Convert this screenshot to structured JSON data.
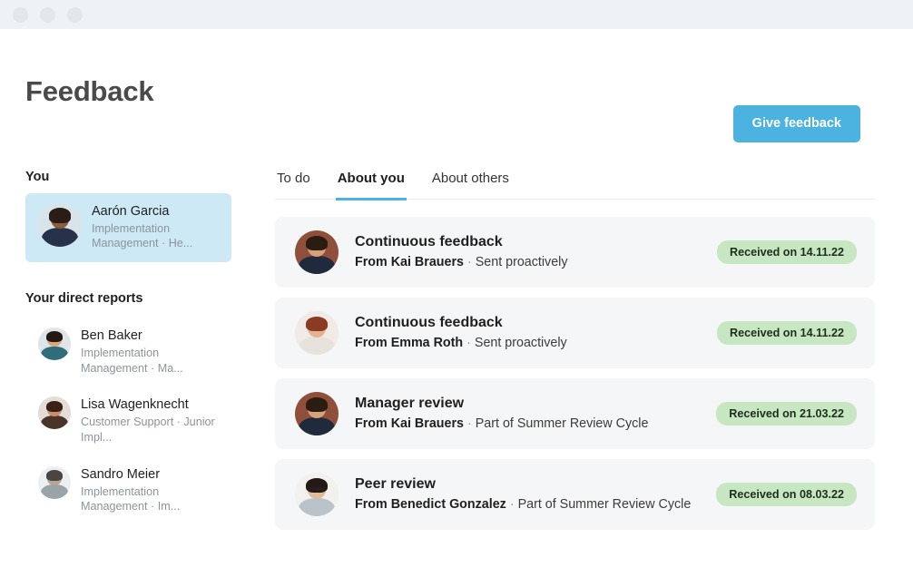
{
  "window": {
    "controls": [
      "close-dot",
      "minimize-dot",
      "maximize-dot"
    ]
  },
  "header": {
    "title": "Feedback",
    "give_feedback_label": "Give feedback",
    "accent_color": "#4cb3e0"
  },
  "sidebar": {
    "you_heading": "You",
    "you": {
      "name": "Aarón Garcia",
      "role": "Implementation Management · He...",
      "selected": true,
      "selected_bg": "#cde9f5"
    },
    "reports_heading": "Your direct reports",
    "reports": [
      {
        "name": "Ben Baker",
        "role": "Implementation Management · Ma..."
      },
      {
        "name": "Lisa Wagenknecht",
        "role": "Customer Support · Junior Impl..."
      },
      {
        "name": "Sandro Meier",
        "role": "Implementation Management · Im..."
      }
    ]
  },
  "main": {
    "tabs": [
      {
        "label": "To do",
        "active": false
      },
      {
        "label": "About you",
        "active": true
      },
      {
        "label": "About others",
        "active": false
      }
    ],
    "cards": [
      {
        "title": "Continuous feedback",
        "from": "From Kai Brauers",
        "separator": "·",
        "context": "Sent proactively",
        "badge": "Received on 14.11.22"
      },
      {
        "title": "Continuous feedback",
        "from": "From Emma Roth",
        "separator": "·",
        "context": "Sent proactively",
        "badge": "Received on 14.11.22"
      },
      {
        "title": "Manager review",
        "from": "From Kai Brauers",
        "separator": "·",
        "context": "Part of Summer Review Cycle",
        "badge": "Received on 21.03.22"
      },
      {
        "title": "Peer review",
        "from": "From Benedict Gonzalez",
        "separator": "·",
        "context": "Part of Summer Review Cycle",
        "badge": "Received on 08.03.22"
      }
    ],
    "badge_color": "#c7e7c2"
  }
}
